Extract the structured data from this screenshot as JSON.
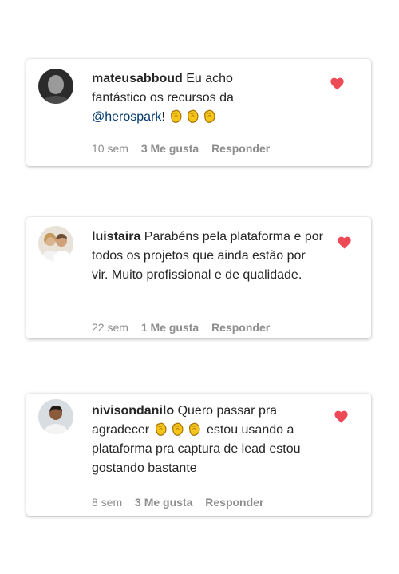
{
  "comments": [
    {
      "username": "mateusabboud",
      "text_before": " Eu acho fantástico os recursos da ",
      "mention": "@herospark",
      "text_after": "!",
      "time": "10 sem",
      "likes": "3 Me gusta",
      "reply": "Responder",
      "liked": true,
      "emojis": [
        "clapping-hands",
        "clapping-hands",
        "clapping-hands"
      ]
    },
    {
      "username": "luistaira",
      "text": " Parabéns pela plataforma e por todos os projetos que ainda estão por vir. Muito profissional e de qualidade.",
      "time": "22 sem",
      "likes": "1 Me gusta",
      "reply": "Responder",
      "liked": true
    },
    {
      "username": "nivisondanilo",
      "text_before": " Quero passar pra agradecer ",
      "text_after": " estou usando a plataforma pra captura de lead estou gostando bastante",
      "time": "8 sem",
      "likes": "3 Me gusta",
      "reply": "Responder",
      "liked": true,
      "emojis": [
        "clapping-hands",
        "clapping-hands",
        "clapping-hands"
      ]
    }
  ],
  "colors": {
    "heart": "#ed4956",
    "meta": "#8e8e8e",
    "mention": "#00376b",
    "clap": "#f5c518"
  }
}
